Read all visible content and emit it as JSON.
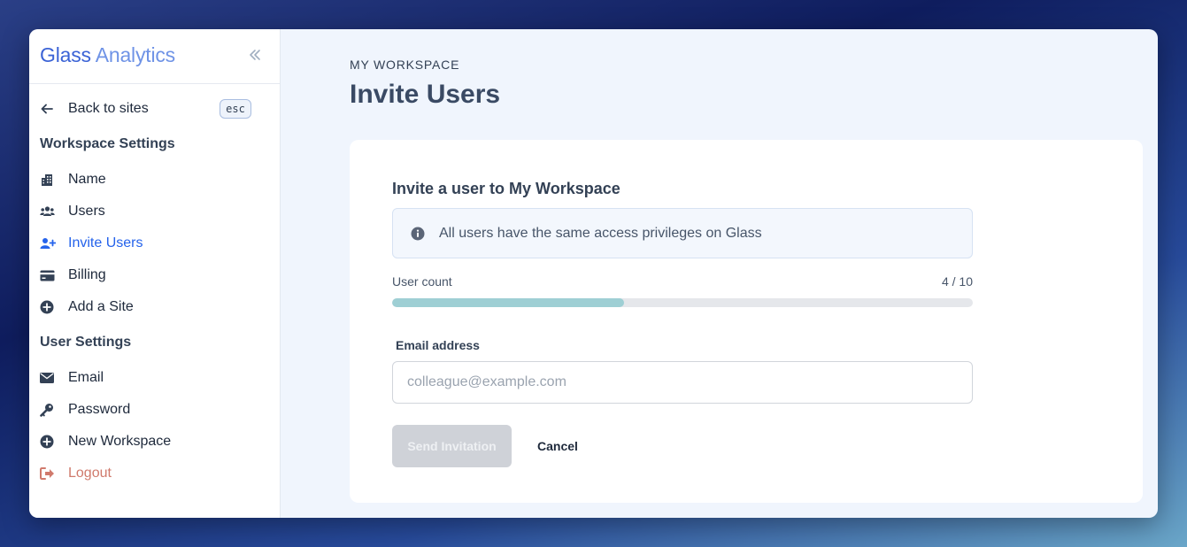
{
  "sidebar": {
    "brand": {
      "part1": "Glass",
      "part2": "Analytics"
    },
    "collapse_icon": "double-chevron-left-icon",
    "back": {
      "label": "Back to sites",
      "shortcut": "esc",
      "icon": "arrow-left-icon"
    },
    "workspace_heading": "Workspace Settings",
    "workspace_items": [
      {
        "label": "Name",
        "icon": "building-icon"
      },
      {
        "label": "Users",
        "icon": "users-icon"
      },
      {
        "label": "Invite Users",
        "icon": "user-plus-icon",
        "active": true
      },
      {
        "label": "Billing",
        "icon": "credit-card-icon"
      },
      {
        "label": "Add a Site",
        "icon": "plus-circle-icon"
      }
    ],
    "user_heading": "User Settings",
    "user_items": [
      {
        "label": "Email",
        "icon": "envelope-icon"
      },
      {
        "label": "Password",
        "icon": "key-icon"
      },
      {
        "label": "New Workspace",
        "icon": "plus-circle-icon"
      },
      {
        "label": "Logout",
        "icon": "logout-icon"
      }
    ]
  },
  "main": {
    "eyebrow": "MY WORKSPACE",
    "title": "Invite Users",
    "card": {
      "heading": "Invite a user to My Workspace",
      "info_text": "All users have the same access privileges on Glass",
      "user_count_label": "User count",
      "user_count_value": "4 / 10",
      "user_count_fraction": 0.4,
      "email_label": "Email address",
      "email_value": "",
      "email_placeholder": "colleague@example.com",
      "send_label": "Send Invitation",
      "cancel_label": "Cancel"
    }
  },
  "colors": {
    "accent": "#2563eb",
    "logout": "#d07a6c",
    "progress_fill": "#9ecfd4"
  }
}
